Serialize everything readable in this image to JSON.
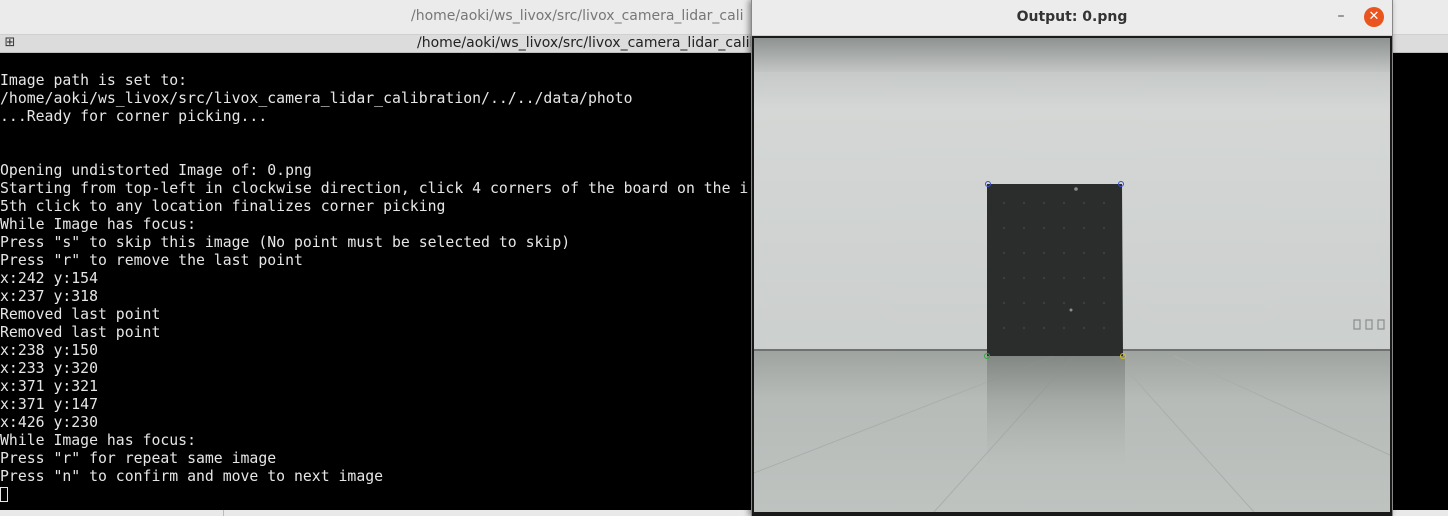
{
  "terminal": {
    "window_title": "/home/aoki/ws_livox/src/livox_camera_lidar_cali",
    "tab_title": "/home/aoki/ws_livox/src/livox_camera_lidar_calib",
    "tab_icon": "new-tab-icon",
    "lines": [
      "Image path is set to:",
      "/home/aoki/ws_livox/src/livox_camera_lidar_calibration/../../data/photo",
      "...Ready for corner picking...",
      "",
      "",
      "Opening undistorted Image of: 0.png",
      "Starting from top-left in clockwise direction, click 4 corners of the board on the i",
      "5th click to any location finalizes corner picking",
      "While Image has focus:",
      "Press \"s\" to skip this image (No point must be selected to skip)",
      "Press \"r\" to remove the last point",
      "x:242 y:154",
      "x:237 y:318",
      "Removed last point",
      "Removed last point",
      "x:238 y:150",
      "x:233 y:320",
      "x:371 y:321",
      "x:371 y:147",
      "x:426 y:230",
      "While Image has focus:",
      "Press \"r\" for repeat same image",
      "Press \"n\" to confirm and move to next image"
    ]
  },
  "image_window": {
    "title": "Output: 0.png",
    "minimize_icon": "minimize-icon",
    "close_icon": "close-icon",
    "minimize_glyph": "–",
    "close_glyph": "✕",
    "colors": {
      "close": "#e9541f",
      "board": "#2a2d2c",
      "corner_top": "#3b4fd6",
      "corner_bottom_right": "#d8c21a",
      "corner_bottom_left": "#2fa63a"
    }
  }
}
